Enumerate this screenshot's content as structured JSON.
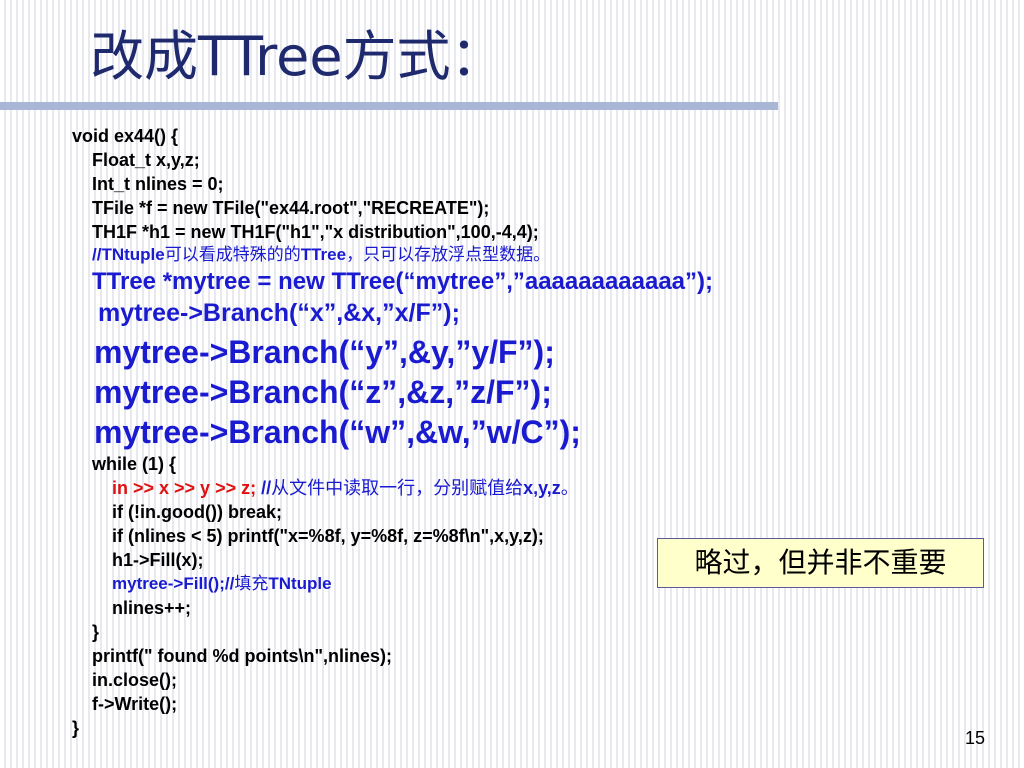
{
  "slide": {
    "title": "改成TTree方式：",
    "note": "略过，但并非不重要",
    "page_number": "15",
    "colors": {
      "title": "#1f2a6e",
      "title_bar": "#a9b6d6",
      "code_blue": "#1a1ad0",
      "code_red": "#e0100f",
      "note_bg": "#ffffcc"
    }
  },
  "code": {
    "l1": "void ex44() {",
    "l2": "Float_t x,y,z;",
    "l3": "Int_t nlines = 0;",
    "l4": "TFile *f = new TFile(\"ex44.root\",\"RECREATE\");",
    "l5": "TH1F *h1 = new TH1F(\"h1\",\"x distribution\",100,-4,4);",
    "l6a": "//TNtuple",
    "l6b": "可以看成特殊的的",
    "l6c": "TTree",
    "l6d": "，只可以存放浮点型数据。",
    "l7": "TTree *mytree = new TTree(“mytree”,”aaaaaaaaaaaa”);",
    "l8": "mytree->Branch(“x”,&x,”x/F”);",
    "l9": "mytree->Branch(“y”,&y,”y/F”);",
    "l10": "mytree->Branch(“z”,&z,”z/F”);",
    "l11": "mytree->Branch(“w”,&w,”w/C”);",
    "l12": "while (1) {",
    "l13a": "in >> x >> y >> z;",
    "l13b": " //",
    "l13c": "从文件中读取一行，分别赋值给",
    "l13d": "x,y,z",
    "l13e": "。",
    "l14": "if (!in.good()) break;",
    "l15": "if (nlines < 5) printf(\"x=%8f, y=%8f, z=%8f\\n\",x,y,z);",
    "l16": "h1->Fill(x);",
    "l17a": "mytree->Fill();//",
    "l17b": "填充",
    "l17c": "TNtuple",
    "l18": "nlines++;",
    "l19": "}",
    "l20": "printf(\" found %d points\\n\",nlines);",
    "l21": "in.close();",
    "l22": "f->Write();",
    "l23": "}"
  }
}
